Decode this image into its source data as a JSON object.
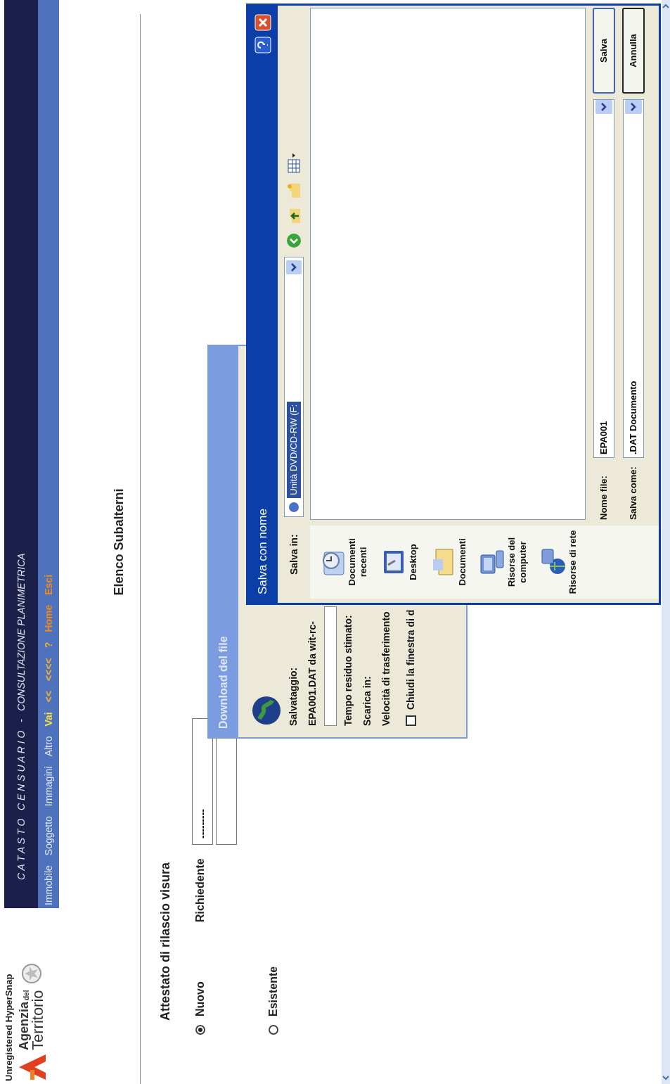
{
  "capture_notice": "Unregistered HyperSnap",
  "logo": {
    "name_top": "Agenzia",
    "name_small": "del",
    "name_bottom": "Territorio"
  },
  "header": {
    "title": "C A T A S T O   C E N S U A R I O   -   CONSULTAZIONE PLANIMETRICA",
    "menu": [
      {
        "label": "Immobile",
        "kind": "section"
      },
      {
        "label": "Soggetto",
        "kind": "section"
      },
      {
        "label": "Immagini",
        "kind": "section"
      },
      {
        "label": "Altro",
        "kind": "section"
      },
      {
        "label": "Vai",
        "kind": "go"
      },
      {
        "label": "<<",
        "kind": "nav"
      },
      {
        "label": "<<<<",
        "kind": "nav"
      },
      {
        "label": "?",
        "kind": "nav"
      },
      {
        "label": "Home",
        "kind": "exit"
      },
      {
        "label": "Esci",
        "kind": "exit"
      }
    ]
  },
  "page": {
    "heading": "Elenco Subalterni",
    "section_title": "Attestato di rilascio visura",
    "options": [
      {
        "label": "Nuovo",
        "selected": true
      },
      {
        "label": "Esistente",
        "selected": false
      }
    ],
    "requester": {
      "label": "Richiedente",
      "value": "---------"
    }
  },
  "download_dialog": {
    "title": "Download del file",
    "saving_label": "Salvataggio:",
    "file": "EPA001.DAT da wit-rc-",
    "remaining_label": "Tempo residuo stimato:",
    "download_to_label": "Scarica in:",
    "speed_label": "Velocità di trasferimento",
    "close_option": {
      "label": "Chiudi la finestra di d",
      "checked": false
    }
  },
  "save_dialog": {
    "title": "Salva con nome",
    "save_in_label": "Salva in:",
    "location": "Unità DVD/CD-RW (F:",
    "places": [
      {
        "label": "Documenti recenti",
        "kind": "recent"
      },
      {
        "label": "Desktop",
        "kind": "desktop"
      },
      {
        "label": "Documenti",
        "kind": "documents"
      },
      {
        "label": "Risorse del computer",
        "kind": "computer"
      },
      {
        "label": "Risorse di rete",
        "kind": "network"
      }
    ],
    "file_name_label": "Nome file:",
    "file_name": "EPA001",
    "save_as_label": "Salva come:",
    "save_as": ".DAT Documento",
    "buttons": [
      {
        "label": "Salva",
        "kind": "default"
      },
      {
        "label": "Annulla",
        "kind": "normal"
      }
    ]
  }
}
